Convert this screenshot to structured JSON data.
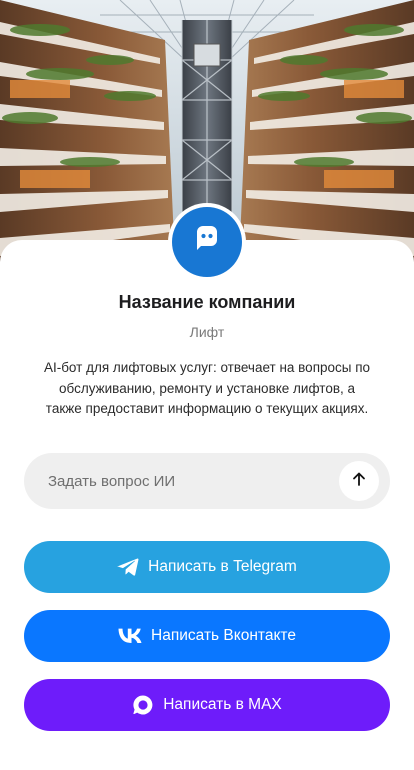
{
  "hero": {
    "image": "atrium-elevator-shaft-photo"
  },
  "profile": {
    "avatar_icon": "chat-bot-icon",
    "company_name": "Название компании",
    "category": "Лифт",
    "description": "AI-бот для лифтовых услуг: отвечает на вопросы по обслуживанию, ремонту и установке лифтов, а также предоставит информацию о текущих акциях."
  },
  "ask": {
    "placeholder": "Задать вопрос ИИ",
    "send_icon": "arrow-up-icon"
  },
  "buttons": {
    "telegram": {
      "label": "Написать в Telegram",
      "icon": "telegram-icon"
    },
    "vk": {
      "label": "Написать Вконтакте",
      "icon": "vk-icon"
    },
    "max": {
      "label": "Написать в MAX",
      "icon": "max-icon"
    }
  },
  "colors": {
    "avatar": "#1877d3",
    "telegram": "#27a2e0",
    "vk": "#0a77ff",
    "max": "#6e1cfa",
    "field_bg": "#efefef",
    "text_dark": "#1d1d1f",
    "text_muted": "#7a7a7a"
  }
}
